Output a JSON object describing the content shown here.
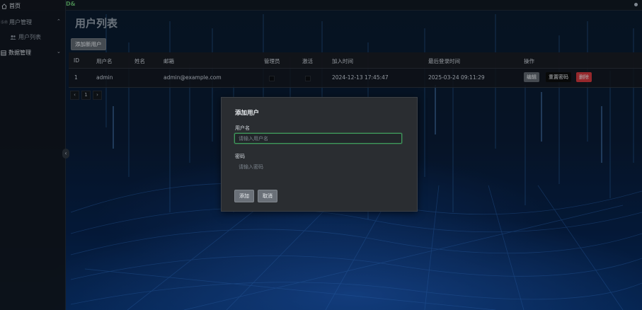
{
  "brand": "D&",
  "sidebar": {
    "items": [
      {
        "label": "首页",
        "icon": "home-icon"
      },
      {
        "label": "用户管理",
        "prefix": "ⓈⓇ",
        "icon": "users-icon"
      },
      {
        "label": "用户列表",
        "icon": "user-list-icon"
      },
      {
        "label": "数据管理",
        "icon": "database-icon"
      }
    ]
  },
  "page": {
    "title": "用户列表",
    "add_button": "添加新用户"
  },
  "table": {
    "columns": [
      "ID",
      "用户名",
      "姓名",
      "邮箱",
      "管理员",
      "激活",
      "加入时间",
      "最后登录时间",
      "操作"
    ],
    "rows": [
      {
        "id": "1",
        "username": "admin",
        "name": "",
        "email": "admin@example.com",
        "is_admin": false,
        "is_active": false,
        "joined": "2024-12-13 17:45:47",
        "last_login": "2025-03-24 09:11:29",
        "actions": {
          "edit": "编辑",
          "reset": "重置密码",
          "delete": "删除"
        }
      }
    ]
  },
  "pagination": {
    "prev": "‹",
    "page": "1",
    "next": "›"
  },
  "modal": {
    "title": "添加用户",
    "username_label": "用户名",
    "username_placeholder": "请输入用户名",
    "username_value": "",
    "password_label": "密码",
    "password_placeholder": "请输入密码",
    "password_value": "",
    "submit": "添加",
    "cancel": "取消"
  },
  "colors": {
    "delete_button": "#c9363b",
    "reset_button": "#0b0c0d",
    "edit_button": "#5d636b",
    "focus_border": "#3f9a5c",
    "brand": "#5fb36a"
  }
}
